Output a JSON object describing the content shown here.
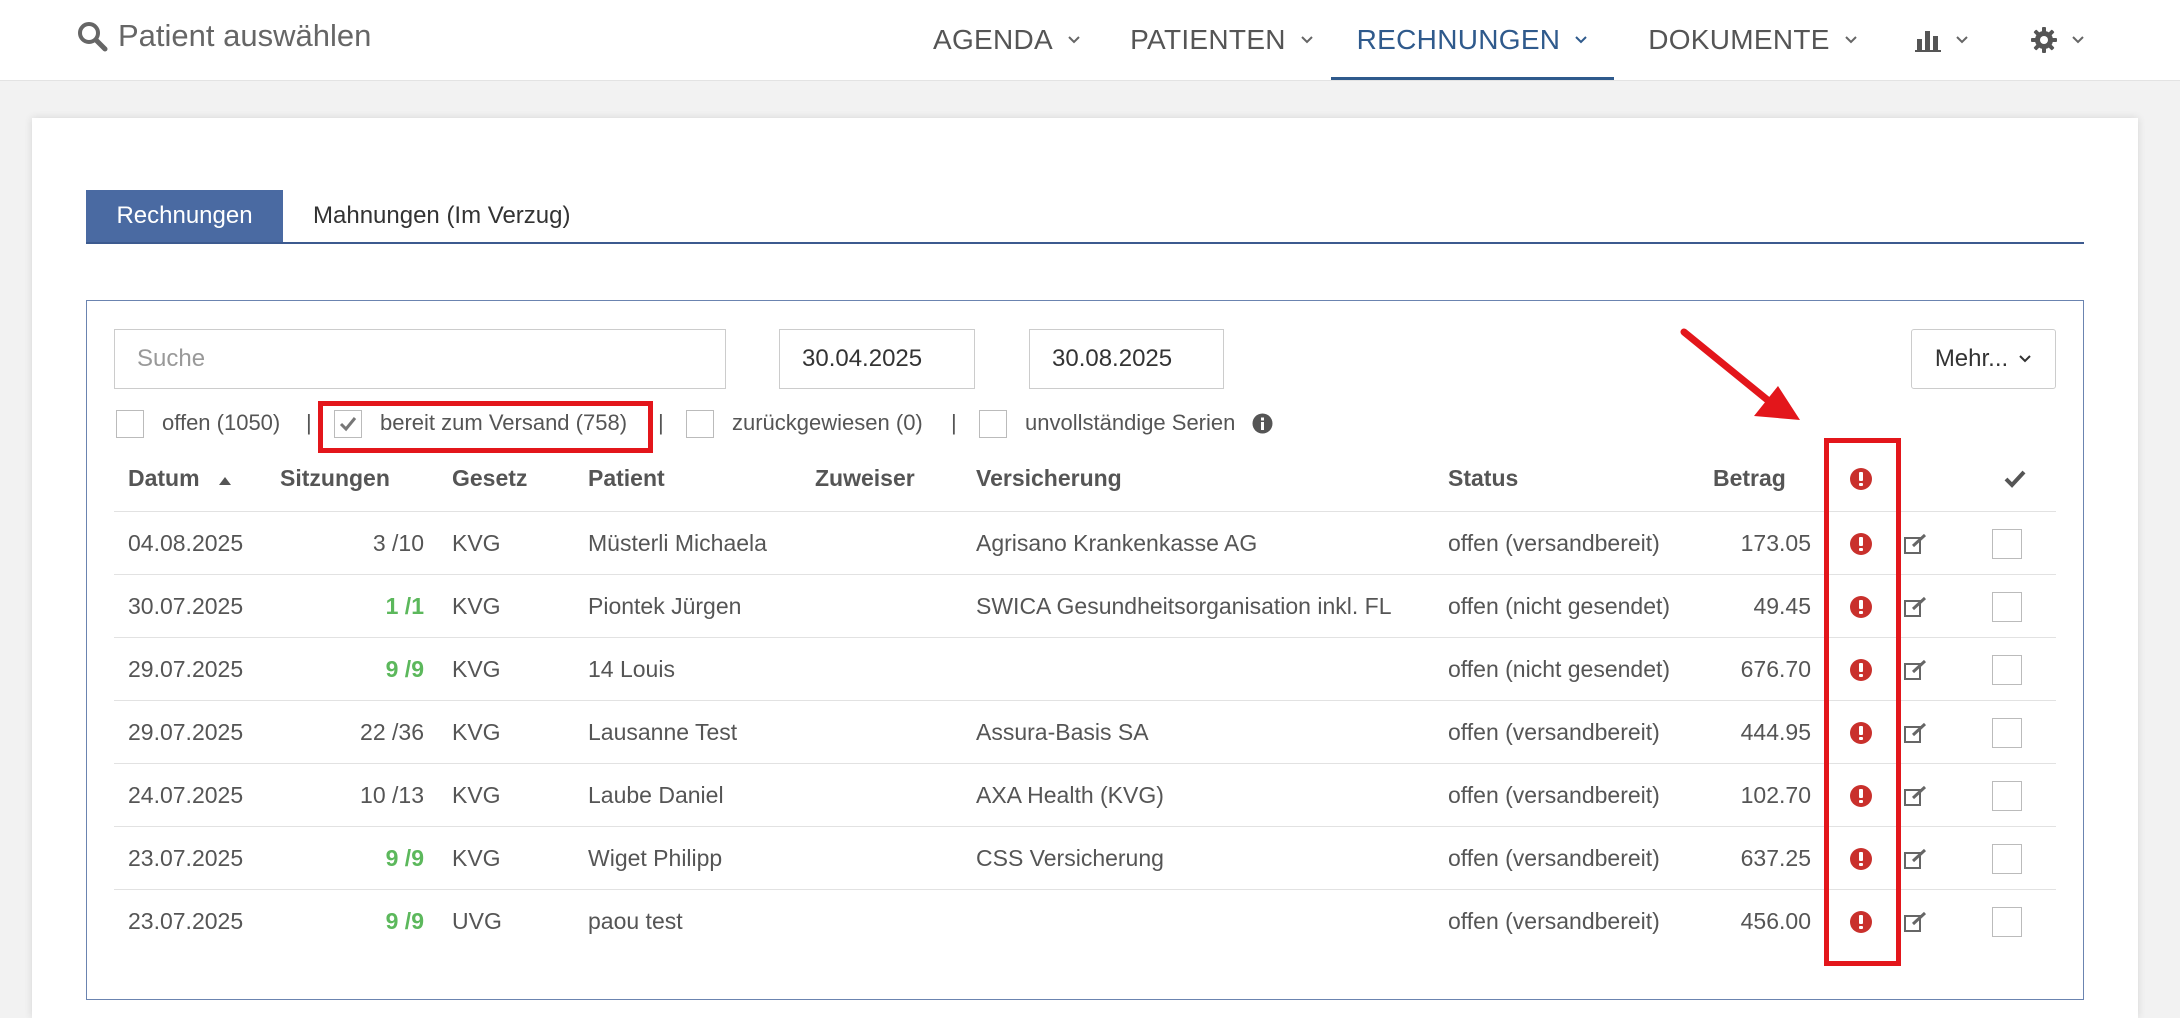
{
  "header": {
    "patient_search": "Patient auswählen",
    "nav": [
      {
        "label": "AGENDA"
      },
      {
        "label": "PATIENTEN"
      },
      {
        "label": "RECHNUNGEN",
        "active": true
      },
      {
        "label": "DOKUMENTE"
      }
    ],
    "icons": [
      "bar-chart-icon",
      "gear-icon"
    ]
  },
  "tabs": [
    {
      "label": "Rechnungen",
      "active": true
    },
    {
      "label": "Mahnungen (Im Verzug)",
      "active": false
    }
  ],
  "filters": {
    "search_placeholder": "Suche",
    "date_from": "30.04.2025",
    "date_to": "30.08.2025",
    "more_label": "Mehr...",
    "checkboxes": [
      {
        "label": "offen (1050)",
        "checked": false
      },
      {
        "label": "bereit zum Versand (758)",
        "checked": true
      },
      {
        "label": "zurückgewiesen (0)",
        "checked": false
      },
      {
        "label": "unvollständige Serien",
        "checked": false
      }
    ],
    "separator": "|"
  },
  "table": {
    "columns": [
      "Datum",
      "Sitzungen",
      "Gesetz",
      "Patient",
      "Zuweiser",
      "Versicherung",
      "Status",
      "Betrag"
    ],
    "rows": [
      {
        "datum": "04.08.2025",
        "sitzungen": "3 /10",
        "complete": false,
        "gesetz": "KVG",
        "patient": "Müsterli Michaela",
        "zuweiser": "",
        "versicherung": "Agrisano Krankenkasse AG",
        "status": "offen (versandbereit)",
        "betrag": "173.05"
      },
      {
        "datum": "30.07.2025",
        "sitzungen": "1 /1",
        "complete": true,
        "gesetz": "KVG",
        "patient": "Piontek Jürgen",
        "zuweiser": "",
        "versicherung": "SWICA Gesundheitsorganisation inkl. FL",
        "status": "offen (nicht gesendet)",
        "betrag": "49.45"
      },
      {
        "datum": "29.07.2025",
        "sitzungen": "9 /9",
        "complete": true,
        "gesetz": "KVG",
        "patient": "14 Louis",
        "zuweiser": "",
        "versicherung": "",
        "status": "offen (nicht gesendet)",
        "betrag": "676.70"
      },
      {
        "datum": "29.07.2025",
        "sitzungen": "22 /36",
        "complete": false,
        "gesetz": "KVG",
        "patient": "Lausanne Test",
        "zuweiser": "",
        "versicherung": "Assura-Basis SA",
        "status": "offen (versandbereit)",
        "betrag": "444.95"
      },
      {
        "datum": "24.07.2025",
        "sitzungen": "10 /13",
        "complete": false,
        "gesetz": "KVG",
        "patient": "Laube Daniel",
        "zuweiser": "",
        "versicherung": "AXA Health (KVG)",
        "status": "offen (versandbereit)",
        "betrag": "102.70"
      },
      {
        "datum": "23.07.2025",
        "sitzungen": "9 /9",
        "complete": true,
        "gesetz": "KVG",
        "patient": "Wiget Philipp",
        "zuweiser": "",
        "versicherung": "CSS Versicherung",
        "status": "offen (versandbereit)",
        "betrag": "637.25"
      },
      {
        "datum": "23.07.2025",
        "sitzungen": "9 /9",
        "complete": true,
        "gesetz": "UVG",
        "patient": "paou test",
        "zuweiser": "",
        "versicherung": "",
        "status": "offen (versandbereit)",
        "betrag": "456.00"
      }
    ]
  },
  "colors": {
    "accent": "#4a6aa2",
    "highlight": "#e3161b",
    "warning": "#c9302c",
    "complete": "#5cb85c"
  }
}
